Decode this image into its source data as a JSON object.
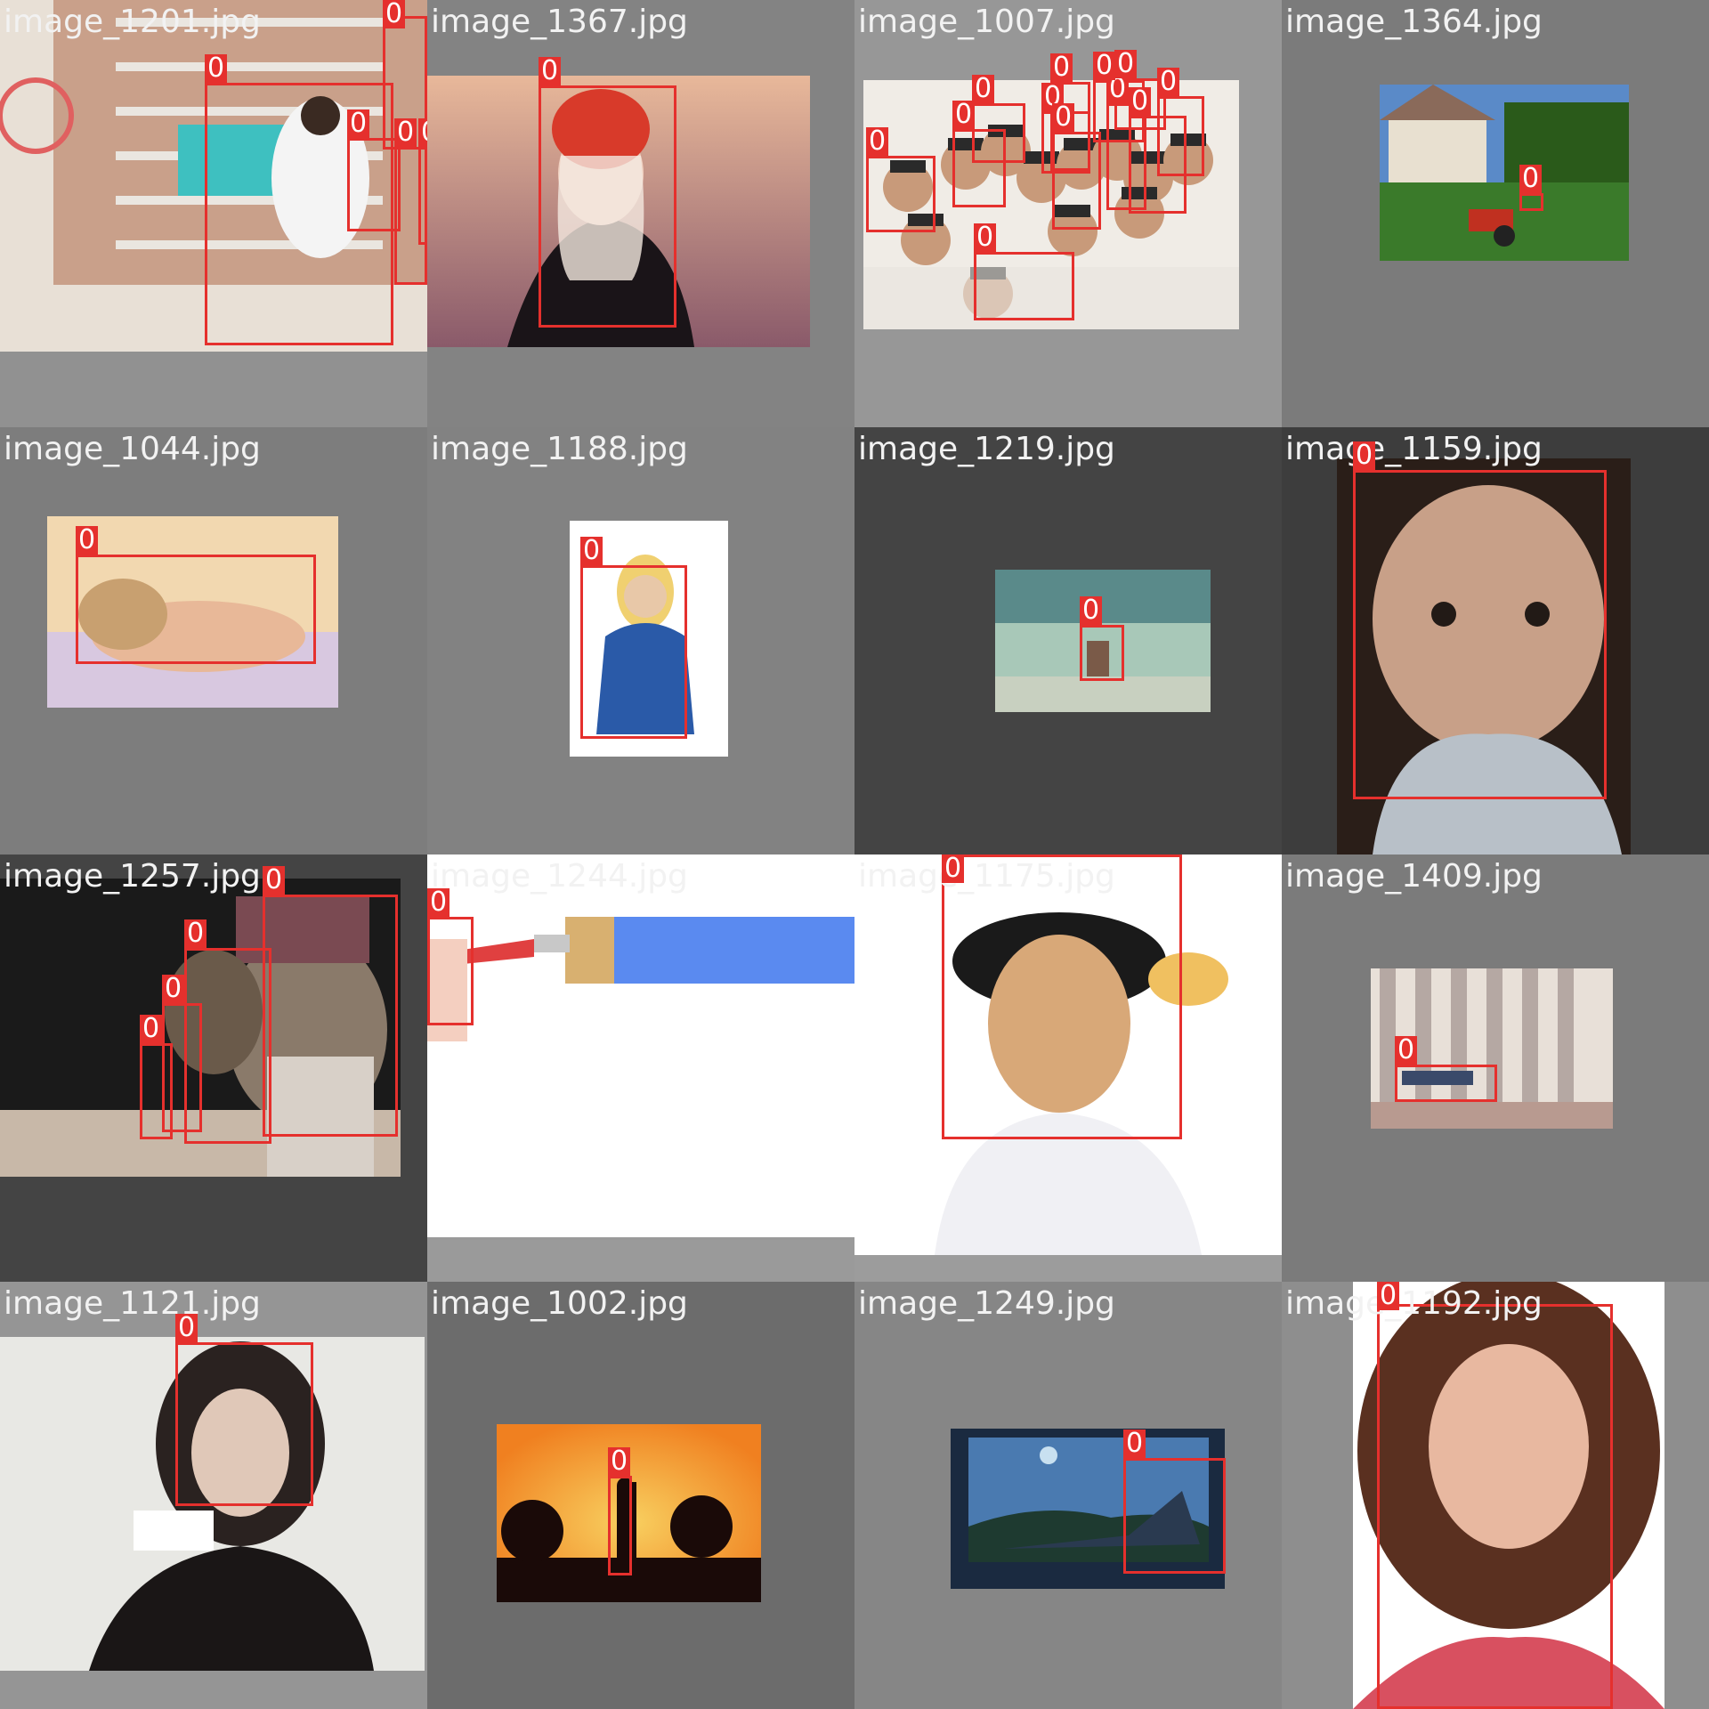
{
  "colors": {
    "box": "#e5302d",
    "label_text": "#ffffff",
    "filename_text": "#f2f2f2"
  },
  "tiles": [
    {
      "filename": "image_1201.jpg",
      "bg": "#919191",
      "scene": "basketball",
      "photo_colors": [
        "#c9a08a",
        "#6d8fa3",
        "#e8e0d6"
      ],
      "detections": [
        {
          "label": "0"
        },
        {
          "label": "0"
        },
        {
          "label": "0"
        },
        {
          "label": "0"
        },
        {
          "label": "0"
        }
      ]
    },
    {
      "filename": "image_1367.jpg",
      "bg": "#838383",
      "scene": "woman in red beanie at sunset",
      "photo_colors": [
        "#e8b89a",
        "#8a5a6a",
        "#3a2a30"
      ],
      "detections": [
        {
          "label": "0"
        }
      ]
    },
    {
      "filename": "image_1007.jpg",
      "bg": "#979797",
      "scene": "group of smiling children",
      "photo_colors": [
        "#f0ece6",
        "#c89a7a",
        "#2a2a2a"
      ],
      "detections": [
        {
          "label": "0"
        },
        {
          "label": "0"
        },
        {
          "label": "0"
        },
        {
          "label": "0"
        },
        {
          "label": "0"
        },
        {
          "label": "0"
        },
        {
          "label": "0"
        },
        {
          "label": "0"
        },
        {
          "label": "0"
        },
        {
          "label": "0"
        },
        {
          "label": "0"
        },
        {
          "label": "0"
        }
      ]
    },
    {
      "filename": "image_1364.jpg",
      "bg": "#7b7b7b",
      "scene": "farmhouse with tractor",
      "photo_colors": [
        "#3a7a2a",
        "#5a8ac8",
        "#e8e0d0"
      ],
      "detections": [
        {
          "label": "0"
        }
      ]
    },
    {
      "filename": "image_1044.jpg",
      "bg": "#7d7d7d",
      "scene": "sleeping newborn",
      "photo_colors": [
        "#f2d8b0",
        "#d8c8e0",
        "#e8b898"
      ],
      "detections": [
        {
          "label": "0"
        }
      ]
    },
    {
      "filename": "image_1188.jpg",
      "bg": "#828282",
      "scene": "woman with headphones",
      "photo_colors": [
        "#ffffff",
        "#2a5aa8",
        "#e8c8a8"
      ],
      "detections": [
        {
          "label": "0"
        }
      ]
    },
    {
      "filename": "image_1219.jpg",
      "bg": "#444444",
      "scene": "person sitting on beach",
      "photo_colors": [
        "#5a8a8a",
        "#a8c8b8",
        "#c8d0c0"
      ],
      "detections": [
        {
          "label": "0"
        }
      ]
    },
    {
      "filename": "image_1159.jpg",
      "bg": "#3d3d3d",
      "scene": "baby close-up",
      "photo_colors": [
        "#2a1e18",
        "#c8a088",
        "#b8c0c8"
      ],
      "detections": [
        {
          "label": "0"
        }
      ]
    },
    {
      "filename": "image_1257.jpg",
      "bg": "#444444",
      "scene": "craftsmen carving",
      "photo_colors": [
        "#1a1a1a",
        "#8a7a6a",
        "#c8b8a8"
      ],
      "detections": [
        {
          "label": "0"
        },
        {
          "label": "0"
        },
        {
          "label": "0"
        },
        {
          "label": "0"
        }
      ]
    },
    {
      "filename": "image_1244.jpg",
      "bg": "#9a9a9a",
      "scene": "hand with paint brush",
      "photo_colors": [
        "#ffffff",
        "#5a8af0",
        "#e04040"
      ],
      "detections": [
        {
          "label": "0"
        }
      ]
    },
    {
      "filename": "image_1175.jpg",
      "bg": "#9c9c9c",
      "scene": "man eating bread",
      "photo_colors": [
        "#ffffff",
        "#1a1a1a",
        "#d8a878"
      ],
      "detections": [
        {
          "label": "0"
        }
      ]
    },
    {
      "filename": "image_1409.jpg",
      "bg": "#7b7b7b",
      "scene": "person lying by building",
      "photo_colors": [
        "#e8e0d8",
        "#8a7a78",
        "#b89a90"
      ],
      "detections": [
        {
          "label": "0"
        }
      ]
    },
    {
      "filename": "image_1121.jpg",
      "bg": "#959595",
      "scene": "woman with glasses holding card",
      "photo_colors": [
        "#e8e8e4",
        "#2a2220",
        "#e0c8b8"
      ],
      "detections": [
        {
          "label": "0"
        }
      ]
    },
    {
      "filename": "image_1002.jpg",
      "bg": "#6c6c6c",
      "scene": "surfer silhouette at sunset",
      "photo_colors": [
        "#1a0a08",
        "#f08020",
        "#f8d060"
      ],
      "detections": [
        {
          "label": "0"
        }
      ]
    },
    {
      "filename": "image_1249.jpg",
      "bg": "#868686",
      "scene": "man by window at night",
      "photo_colors": [
        "#1a2a40",
        "#4a7ab0",
        "#c8e0f0"
      ],
      "detections": [
        {
          "label": "0"
        }
      ]
    },
    {
      "filename": "image_1192.jpg",
      "bg": "#8e8e8e",
      "scene": "smiling curly-haired woman",
      "photo_colors": [
        "#ffffff",
        "#5a3020",
        "#d85060"
      ],
      "detections": [
        {
          "label": "0"
        }
      ]
    }
  ]
}
